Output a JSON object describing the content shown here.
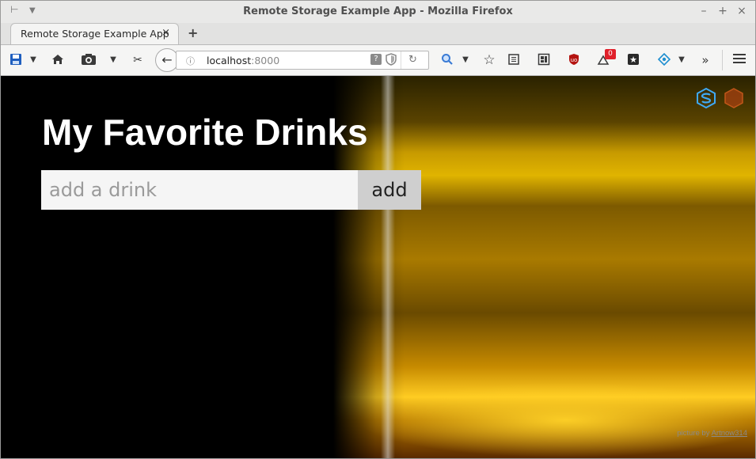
{
  "window": {
    "title": "Remote Storage Example App - Mozilla Firefox",
    "controls": {
      "minimize": "–",
      "maximize": "+",
      "close": "×"
    }
  },
  "tabs": [
    {
      "label": "Remote Storage Example App",
      "close": "×"
    }
  ],
  "new_tab": "+",
  "url": {
    "host": "localhost",
    "port": ":8000"
  },
  "toolbar": {
    "notification_badge": "0"
  },
  "app": {
    "heading": "My Favorite Drinks",
    "input_placeholder": "add a drink",
    "input_value": "",
    "add_label": "add",
    "credit_prefix": "picture by ",
    "credit_link": "Artnow314"
  },
  "colors": {
    "badge": "#e0202a",
    "remotestorage_logo": "#3fa9f5",
    "widget_hexagon": "#e06020",
    "ublock": "#b41410"
  },
  "icons": [
    "save-icon",
    "home-icon",
    "screenshot-icon",
    "scissors-icon",
    "back-icon",
    "info-icon",
    "help-icon",
    "shield-icon",
    "reload-icon",
    "search-icon",
    "star-icon",
    "reader-icon",
    "containers-icon",
    "ublock-icon",
    "notifications-icon",
    "extension-icon",
    "diamond-icon",
    "overflow-icon",
    "menu-icon"
  ]
}
